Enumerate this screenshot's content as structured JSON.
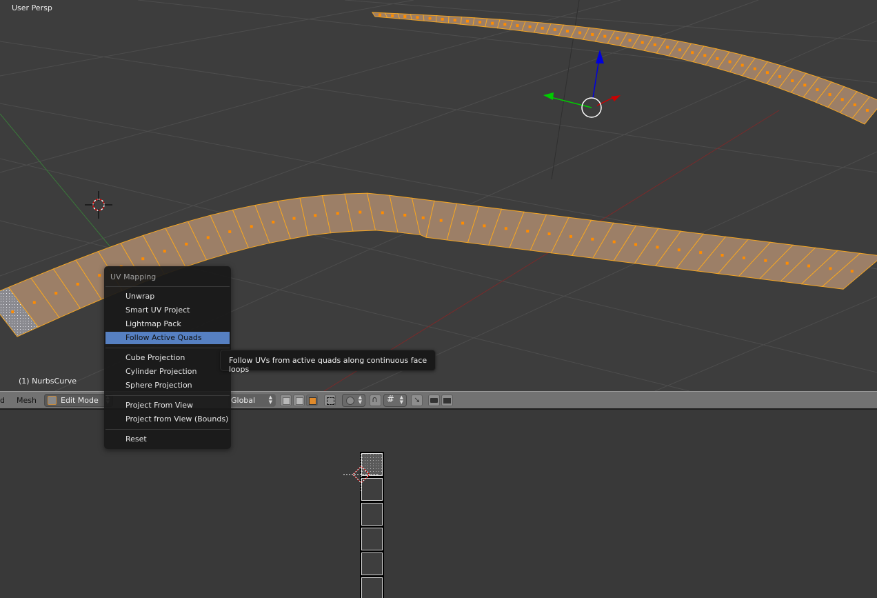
{
  "viewport": {
    "view_name": "User Persp",
    "object_name": "(1) NurbsCurve",
    "colors": {
      "background": "#3d3d3d",
      "grid": "#4a4a4a",
      "selection_edge": "#f5a623",
      "face_fill": "#9c7f67",
      "face_dot": "#ff8c00",
      "axis_x": "#cc0000",
      "axis_y": "#00cc00",
      "axis_z": "#0000dd"
    }
  },
  "header": {
    "partial_menu_label": "d",
    "mesh_menu_label": "Mesh",
    "mode_selector": {
      "value": "Edit Mode",
      "icon": "edit-mode-icon"
    },
    "orientation_selector": {
      "value": "Global"
    },
    "select_modes": [
      "vertex-select-icon",
      "edge-select-icon",
      "face-select-icon"
    ],
    "active_select_mode": "face",
    "tool_icons": [
      "limit-selection-icon",
      "proportional-edit-icon",
      "snap-magnet-icon",
      "snap-target-icon",
      "snap-align-icon",
      "render-camera-icon",
      "render-animation-icon"
    ]
  },
  "menu": {
    "title": "UV Mapping",
    "groups": [
      [
        {
          "label": "Unwrap"
        },
        {
          "label": "Smart UV Project"
        },
        {
          "label": "Lightmap Pack"
        },
        {
          "label": "Follow Active Quads",
          "active": true
        }
      ],
      [
        {
          "label": "Cube Projection"
        },
        {
          "label": "Cylinder Projection"
        },
        {
          "label": "Sphere Projection"
        }
      ],
      [
        {
          "label": "Project From View"
        },
        {
          "label": "Project from View (Bounds)"
        }
      ],
      [
        {
          "label": "Reset"
        }
      ]
    ]
  },
  "tooltip": {
    "text": "Follow UVs from active quads along continuous face loops"
  },
  "uv_editor": {
    "uv_cells": 6,
    "selected_cell_index": 0
  }
}
